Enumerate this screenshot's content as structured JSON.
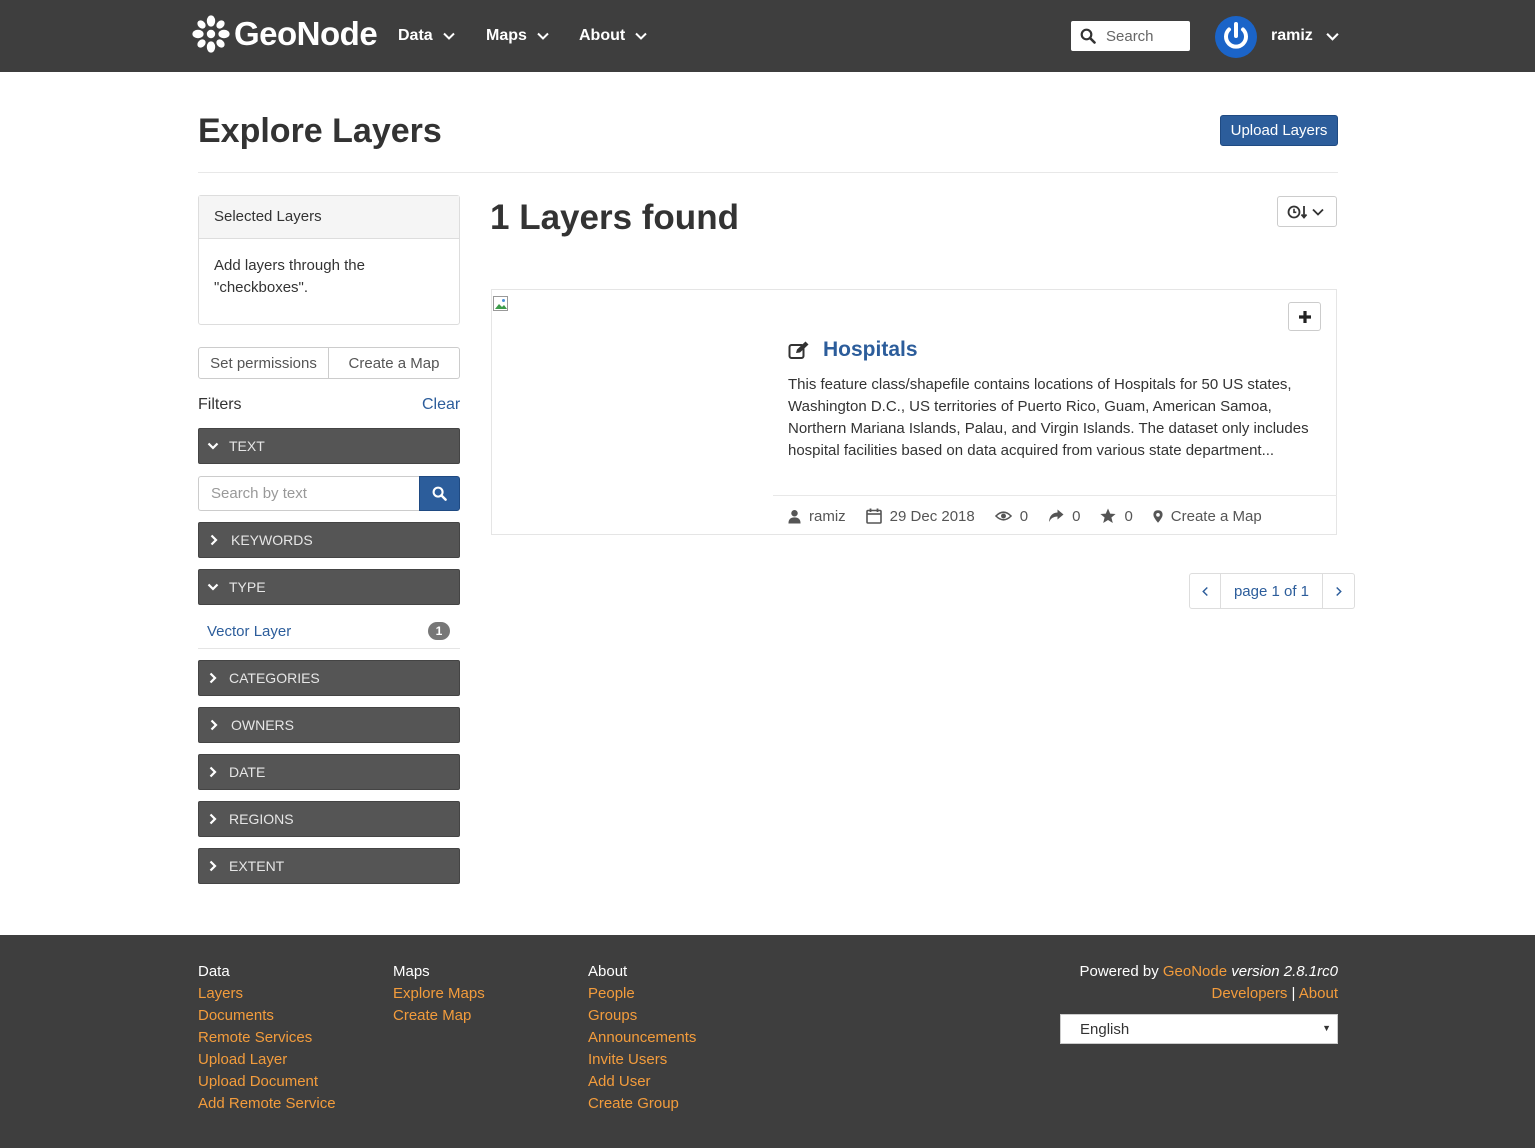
{
  "nav": {
    "brand": "GeoNode",
    "items": [
      {
        "label": "Data"
      },
      {
        "label": "Maps"
      },
      {
        "label": "About"
      }
    ],
    "search_placeholder": "Search",
    "username": "ramiz"
  },
  "header": {
    "title": "Explore Layers",
    "upload_label": "Upload Layers"
  },
  "sidebar": {
    "selected_heading": "Selected Layers",
    "selected_body": "Add layers through the \"checkboxes\".",
    "set_permissions": "Set permissions",
    "create_map": "Create a Map",
    "filters_label": "Filters",
    "clear_label": "Clear",
    "text_search_placeholder": "Search by text",
    "filters": [
      {
        "label": "TEXT",
        "expanded": true
      },
      {
        "label": "KEYWORDS",
        "expanded": false
      },
      {
        "label": "TYPE",
        "expanded": true
      },
      {
        "label": "CATEGORIES",
        "expanded": false
      },
      {
        "label": "OWNERS",
        "expanded": false
      },
      {
        "label": "DATE",
        "expanded": false
      },
      {
        "label": "REGIONS",
        "expanded": false
      },
      {
        "label": "EXTENT",
        "expanded": false
      }
    ],
    "type_option": {
      "label": "Vector Layer",
      "count": "1"
    }
  },
  "main": {
    "found_title": "1 Layers found",
    "layer": {
      "title": "Hospitals",
      "abstract": "This feature class/shapefile contains locations of Hospitals for 50 US states, Washington D.C., US territories of Puerto Rico, Guam, American Samoa, Northern Mariana Islands, Palau, and Virgin Islands. The dataset only includes hospital facilities based on data acquired from various state department...",
      "owner": "ramiz",
      "date": "29 Dec 2018",
      "views": "0",
      "shares": "0",
      "rating": "0",
      "create_map": "Create a Map"
    },
    "pagination": {
      "label": "page 1 of 1"
    }
  },
  "footer": {
    "columns": [
      {
        "heading": "Data",
        "links": [
          "Layers",
          "Documents",
          "Remote Services",
          "Upload Layer",
          "Upload Document",
          "Add Remote Service"
        ]
      },
      {
        "heading": "Maps",
        "links": [
          "Explore Maps",
          "Create Map"
        ]
      },
      {
        "heading": "About",
        "links": [
          "People",
          "Groups",
          "Announcements",
          "Invite Users",
          "Add User",
          "Create Group"
        ]
      }
    ],
    "powered_prefix": "Powered by",
    "powered_brand": "GeoNode",
    "version_text": "version 2.8.1rc0",
    "developers": "Developers",
    "separator": "|",
    "about": "About",
    "language": "English"
  },
  "colors": {
    "navbar": "#3e3e3e",
    "primary": "#2c5d9b",
    "footer_link": "#f39c3c",
    "filter_bar": "#555555"
  }
}
